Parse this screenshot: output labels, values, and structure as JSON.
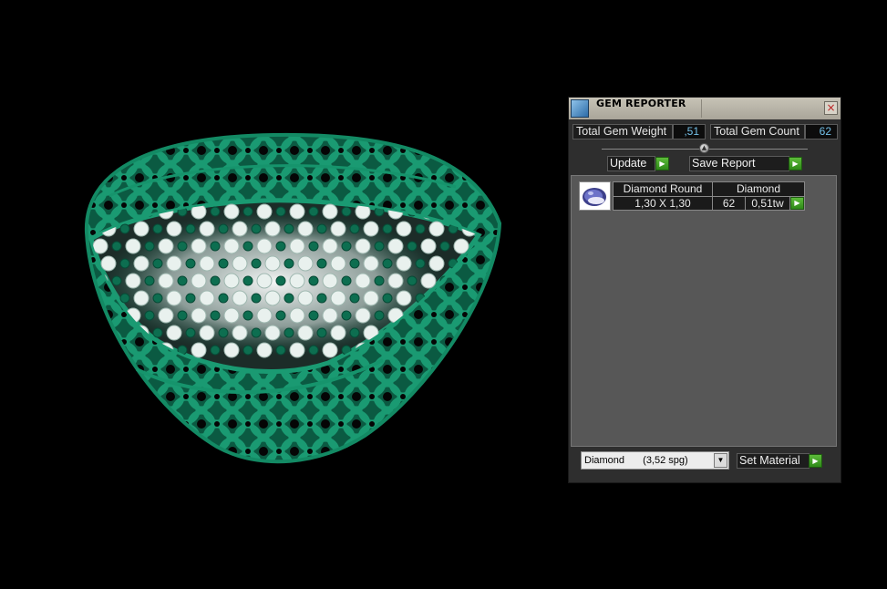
{
  "panel": {
    "title": "GEM REPORTER",
    "close_glyph": "×",
    "total_gem_weight_label": "Total Gem Weight",
    "total_gem_weight_value": ",51",
    "total_gem_count_label": "Total Gem Count",
    "total_gem_count_value": "62",
    "update_label": "Update",
    "save_report_label": "Save Report",
    "arrow_glyph": "▶",
    "knob_glyph": "▲",
    "gem_list": {
      "rows": [
        {
          "thumbnail_icon": "round-gem-icon",
          "shape": "Diamond Round",
          "material": "Diamond",
          "size": "1,30 X 1,30",
          "count": "62",
          "weight": "0,51tw"
        }
      ]
    },
    "material_select": {
      "selected_name": "Diamond",
      "selected_density": "(3,52 spg)",
      "arrow_glyph": "▼"
    },
    "set_material_label": "Set Material"
  },
  "colors": {
    "ring_green": "#0f7a5a",
    "value_text": "#74c0e8",
    "button_arrow": "#3fa12a"
  }
}
